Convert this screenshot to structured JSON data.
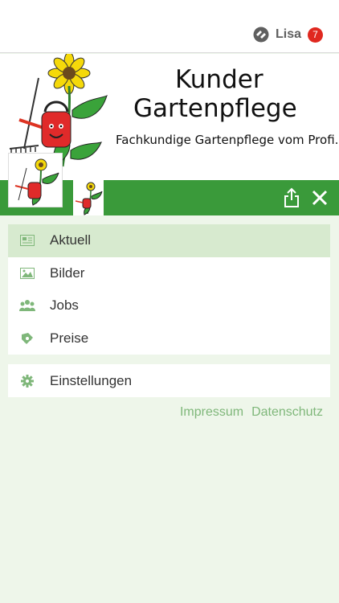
{
  "user": {
    "name": "Lisa",
    "notifications": "7"
  },
  "banner": {
    "title_line1": "Kunder",
    "title_line2": "Gartenpflege",
    "tagline": "Fachkundige Gartenpflege vom Profi."
  },
  "menu": {
    "items": [
      {
        "label": "Aktuell",
        "icon": "newspaper-icon",
        "active": true
      },
      {
        "label": "Bilder",
        "icon": "image-icon",
        "active": false
      },
      {
        "label": "Jobs",
        "icon": "people-icon",
        "active": false
      },
      {
        "label": "Preise",
        "icon": "price-tag-icon",
        "active": false
      }
    ],
    "settings_label": "Einstellungen"
  },
  "footer": {
    "impressum": "Impressum",
    "datenschutz": "Datenschutz"
  },
  "colors": {
    "green": "#3a9a3a",
    "active_bg": "#d7eacf",
    "icon": "#7fb77a",
    "badge": "#e0281f"
  }
}
